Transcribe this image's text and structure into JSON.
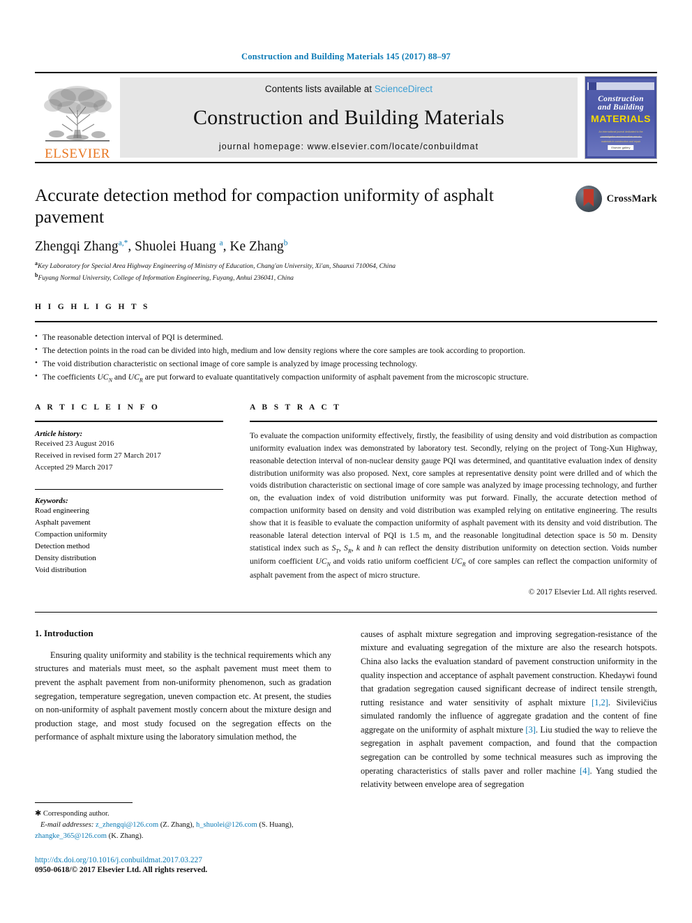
{
  "header": {
    "journal_reference": "Construction and Building Materials 145 (2017) 88–97"
  },
  "masthead": {
    "contents_prefix": "Contents lists available at",
    "sciencedirect": "ScienceDirect",
    "journal_title": "Construction and Building Materials",
    "homepage": "journal homepage: www.elsevier.com/locate/conbuildmat",
    "publisher_name": "ELSEVIER",
    "cover": {
      "line1": "Construction",
      "line2": "and Building",
      "line3": "MATERIALS",
      "blurb": "An international journal dedicated to the investigation and innovative use of materials in construction and repair",
      "footer": "Elsevier gallery"
    }
  },
  "article": {
    "title": "Accurate detection method for compaction uniformity of asphalt pavement",
    "crossmark_label": "CrossMark",
    "authors": [
      {
        "name": "Zhengqi Zhang",
        "marks": "a,*"
      },
      {
        "name": "Shuolei Huang",
        "marks": "a"
      },
      {
        "name": "Ke Zhang",
        "marks": "b"
      }
    ],
    "affiliations": [
      {
        "mark": "a",
        "text": "Key Laboratory for Special Area Highway Engineering of Ministry of Education, Chang'an University, Xi'an, Shaanxi 710064, China"
      },
      {
        "mark": "b",
        "text": "Fuyang Normal University, College of Information Engineering, Fuyang, Anhui 236041, China"
      }
    ]
  },
  "highlights": {
    "heading": "H I G H L I G H T S",
    "items": [
      "The reasonable detection interval of PQI is determined.",
      "The detection points in the road can be divided into high, medium and low density regions where the core samples are took according to proportion.",
      "The void distribution characteristic on sectional image of core sample is analyzed by image processing technology.",
      "The coefficients UC_N and UC_R are put forward to evaluate quantitatively compaction uniformity of asphalt pavement from the microscopic structure."
    ]
  },
  "article_info": {
    "heading": "A R T I C L E    I N F O",
    "history_label": "Article history:",
    "history": [
      "Received 23 August 2016",
      "Received in revised form 27 March 2017",
      "Accepted 29 March 2017"
    ],
    "keywords_label": "Keywords:",
    "keywords": [
      "Road engineering",
      "Asphalt pavement",
      "Compaction uniformity",
      "Detection method",
      "Density distribution",
      "Void distribution"
    ]
  },
  "abstract": {
    "heading": "A B S T R A C T",
    "text_part1": "To evaluate the compaction uniformity effectively, firstly, the feasibility of using density and void distribution as compaction uniformity evaluation index was demonstrated by laboratory test. Secondly, relying on the project of Tong-Xun Highway, reasonable detection interval of non-nuclear density gauge PQI was determined, and quantitative evaluation index of density distribution uniformity was also proposed. Next, core samples at representative density point were drilled and of which the voids distribution characteristic on sectional image of core sample was analyzed by image processing technology, and further on, the evaluation index of void distribution uniformity was put forward. Finally, the accurate detection method of compaction uniformity based on density and void distribution was exampled relying on entitative engineering. The results show that it is feasible to evaluate the compaction uniformity of asphalt pavement with its density and void distribution. The reasonable lateral detection interval of PQI is 1.5 m, and the reasonable longitudinal detection space is 50 m. Density statistical index such as ",
    "inline_sym1": "S",
    "inline_sub1": "T",
    "inline_sym2": "S",
    "inline_sub2": "R",
    "inline_sym3": "k",
    "inline_sym4": "h",
    "text_part2": " can reflect the density distribution uniformity on detection section. Voids number uniform coefficient ",
    "ucn": "UC",
    "ucn_sub": "N",
    "text_part3": " and voids ratio uniform coefficient ",
    "ucr": "UC",
    "ucr_sub": "R",
    "text_part4": " of core samples can reflect the compaction uniformity of asphalt pavement from the aspect of micro structure.",
    "copyright": "© 2017 Elsevier Ltd. All rights reserved."
  },
  "body": {
    "section_heading": "1. Introduction",
    "left_paragraph": "Ensuring quality uniformity and stability is the technical requirements which any structures and materials must meet, so the asphalt pavement must meet them to prevent the asphalt pavement from non-uniformity phenomenon, such as gradation segregation, temperature segregation, uneven compaction etc. At present, the studies on non-uniformity of asphalt pavement mostly concern about the mixture design and production stage, and most study focused on the segregation effects on the performance of asphalt mixture using the laboratory simulation method, the",
    "right_paragraph_a": "causes of asphalt mixture segregation and improving segregation-resistance of the mixture and evaluating segregation of the mixture are also the research hotspots. China also lacks the evaluation standard of pavement construction uniformity in the quality inspection and acceptance of asphalt pavement construction. Khedaywi found that gradation segregation caused significant decrease of indirect tensile strength, rutting resistance and water sensitivity of asphalt mixture ",
    "ref1": "[1,2]",
    "right_paragraph_b": ". Sivilevičius simulated randomly the influence of aggregate gradation and the content of fine aggregate on the uniformity of asphalt mixture ",
    "ref2": "[3]",
    "right_paragraph_c": ". Liu studied the way to relieve the segregation in asphalt pavement compaction, and found that the compaction segregation can be controlled by some technical measures such as improving the operating characteristics of stalls paver and roller machine ",
    "ref3": "[4]",
    "right_paragraph_d": ". Yang studied the relativity between envelope area of segregation"
  },
  "footnote": {
    "corresponding": "Corresponding author.",
    "email_label": "E-mail addresses:",
    "emails": [
      {
        "address": "z_zhengqi@126.com",
        "owner": "(Z. Zhang),"
      },
      {
        "address": "h_shuolei@126.com",
        "owner": "(S. Huang),"
      },
      {
        "address": "zhangke_365@126.com",
        "owner": "(K. Zhang)."
      }
    ],
    "doi": "http://dx.doi.org/10.1016/j.conbuildmat.2017.03.227",
    "issn": "0950-0618/© 2017 Elsevier Ltd. All rights reserved."
  },
  "colors": {
    "link_blue": "#0b7ab5",
    "elsevier_orange": "#e87722",
    "cover_blue": "#4450a0",
    "cover_yellow": "#f5d900"
  }
}
